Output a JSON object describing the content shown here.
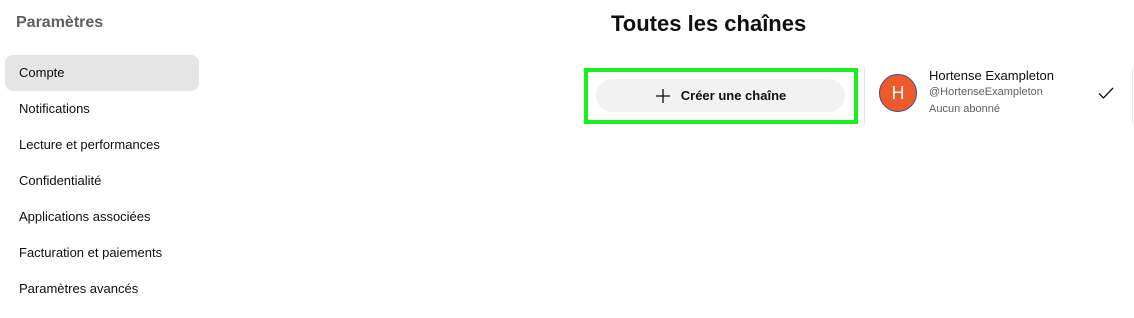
{
  "sidebar": {
    "title": "Paramètres",
    "items": [
      {
        "label": "Compte",
        "active": true
      },
      {
        "label": "Notifications"
      },
      {
        "label": "Lecture et performances"
      },
      {
        "label": "Confidentialité"
      },
      {
        "label": "Applications associées"
      },
      {
        "label": "Facturation et paiements"
      },
      {
        "label": "Paramètres avancés"
      }
    ]
  },
  "main": {
    "title": "Toutes les chaînes",
    "create_button": {
      "label": "Créer une chaîne",
      "icon": "plus-icon"
    },
    "highlight_color": "#1af01a",
    "channel": {
      "avatar_letter": "H",
      "avatar_color": "#ef5a28",
      "name": "Hortense Exampleton",
      "handle": "@HortenseExampleton",
      "subscribers": "Aucun abonné",
      "selected_icon": "check-icon"
    }
  }
}
